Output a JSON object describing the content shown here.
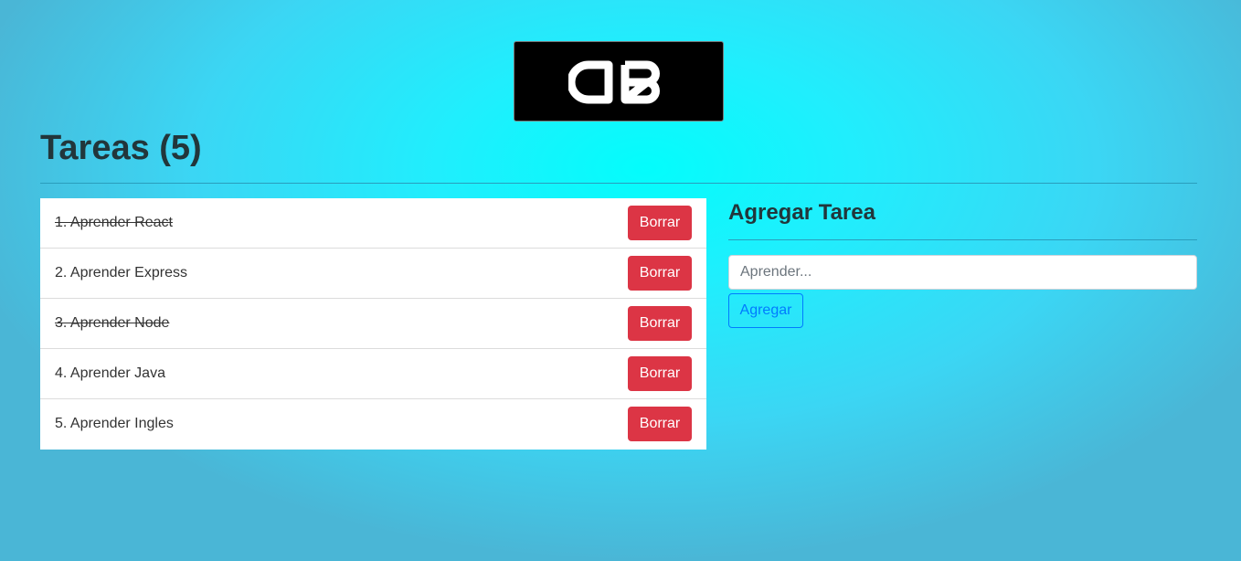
{
  "logo": {
    "text": "DB"
  },
  "header": {
    "title": "Tareas (5)"
  },
  "tasks": [
    {
      "label": "1. Aprender React",
      "completed": true,
      "delete_label": "Borrar"
    },
    {
      "label": "2. Aprender Express",
      "completed": false,
      "delete_label": "Borrar"
    },
    {
      "label": "3. Aprender Node",
      "completed": true,
      "delete_label": "Borrar"
    },
    {
      "label": "4. Aprender Java",
      "completed": false,
      "delete_label": "Borrar"
    },
    {
      "label": "5. Aprender Ingles",
      "completed": false,
      "delete_label": "Borrar"
    }
  ],
  "form": {
    "title": "Agregar Tarea",
    "input_placeholder": "Aprender...",
    "input_value": "",
    "submit_label": "Agregar"
  },
  "colors": {
    "danger": "#dc3545",
    "primary": "#007bff",
    "background_center": "#03fdfc",
    "background_edge": "#4ab6d6"
  }
}
